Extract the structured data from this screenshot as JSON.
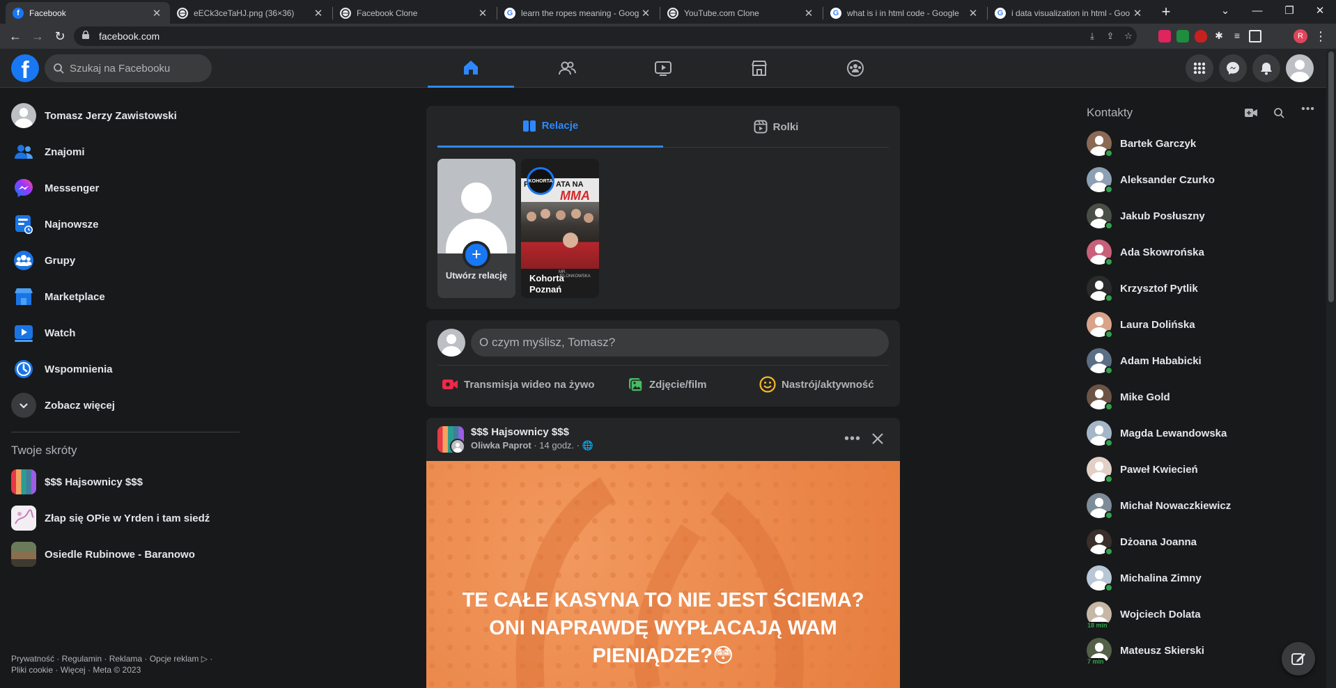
{
  "browser": {
    "tabs": [
      {
        "title": "Facebook",
        "active": true
      },
      {
        "title": "eECk3ceTaHJ.png (36×36)",
        "active": false
      },
      {
        "title": "Facebook Clone",
        "active": false
      },
      {
        "title": "learn the ropes meaning - Goog",
        "active": false
      },
      {
        "title": "YouTube.com Clone",
        "active": false
      },
      {
        "title": "what is i in html code - Google",
        "active": false
      },
      {
        "title": "i data visualization in html - Goo",
        "active": false
      }
    ],
    "address": "facebook.com",
    "profile_initial": "R"
  },
  "fb": {
    "logo": "f",
    "search_placeholder": "Szukaj na Facebooku",
    "user_name": "Tomasz Jerzy Zawistowski"
  },
  "left_menu": [
    {
      "label": "Znajomi",
      "icon": "friends-icon"
    },
    {
      "label": "Messenger",
      "icon": "messenger-icon"
    },
    {
      "label": "Najnowsze",
      "icon": "feeds-icon"
    },
    {
      "label": "Grupy",
      "icon": "groups-icon"
    },
    {
      "label": "Marketplace",
      "icon": "marketplace-icon"
    },
    {
      "label": "Watch",
      "icon": "watch-icon"
    },
    {
      "label": "Wspomnienia",
      "icon": "memories-icon"
    },
    {
      "label": "Zobacz więcej",
      "icon": "chevron-down-icon"
    }
  ],
  "shortcuts": {
    "heading": "Twoje skróty",
    "items": [
      {
        "label": "$$$ Hajsownicy $$$"
      },
      {
        "label": "Złap się OPie w Yrden i tam siedź"
      },
      {
        "label": "Osiedle Rubinowe - Baranowo"
      }
    ]
  },
  "footer": {
    "line1": "Prywatność · Regulamin · Reklama · Opcje reklam ▷ ·",
    "line2": "Pliki cookie · Więcej · Meta © 2023"
  },
  "stories": {
    "tab_active": "Relacje",
    "tab_other": "Rolki",
    "create_label": "Utwórz relację",
    "story_name": "Kohorta Poznań",
    "story_banner_left": "PE",
    "story_banner_right": "ATA NA",
    "story_mma": "MMA",
    "story_badge": "KOHORTA",
    "story_caption": "MR. JELONKOWSKA"
  },
  "composer": {
    "placeholder": "O czym myślisz, Tomasz?",
    "actions": [
      {
        "label": "Transmisja wideo na żywo",
        "color": "#f02849"
      },
      {
        "label": "Zdjęcie/film",
        "color": "#45bd62"
      },
      {
        "label": "Nastrój/aktywność",
        "color": "#f7b928"
      }
    ]
  },
  "post": {
    "group": "$$$ Hajsownicy $$$",
    "author": "Oliwka Paprot",
    "time": "14 godz.",
    "text_line1": "TE CAŁE KASYNA TO NIE JEST ŚCIEMA?",
    "text_line2": "ONI NAPRAWDĘ WYPŁACAJĄ WAM",
    "text_line3": "PIENIĄDZE?😳"
  },
  "contacts": {
    "heading": "Kontakty",
    "items": [
      {
        "name": "Bartek Garczyk",
        "tone": "#8a6a55",
        "mins": ""
      },
      {
        "name": "Aleksander Czurko",
        "tone": "#8da0b3",
        "mins": ""
      },
      {
        "name": "Jakub Posłuszny",
        "tone": "#4a4f46",
        "mins": ""
      },
      {
        "name": "Ada Skowrońska",
        "tone": "#c9607a",
        "mins": ""
      },
      {
        "name": "Krzysztof Pytlik",
        "tone": "#2b2b2b",
        "mins": ""
      },
      {
        "name": "Laura Dolińska",
        "tone": "#d9a38a",
        "mins": ""
      },
      {
        "name": "Adam Hababicki",
        "tone": "#5a6e86",
        "mins": ""
      },
      {
        "name": "Mike Gold",
        "tone": "#6b5446",
        "mins": ""
      },
      {
        "name": "Magda Lewandowska",
        "tone": "#a4b6c8",
        "mins": ""
      },
      {
        "name": "Paweł Kwiecień",
        "tone": "#e2d0c6",
        "mins": ""
      },
      {
        "name": "Michał Nowaczkiewicz",
        "tone": "#7d8c98",
        "mins": ""
      },
      {
        "name": "Dżoana Joanna",
        "tone": "#3a2f2a",
        "mins": ""
      },
      {
        "name": "Michalina Zimny",
        "tone": "#b8c7d6",
        "mins": ""
      },
      {
        "name": "Wojciech Dolata",
        "tone": "#c7b7a6",
        "mins": "18 min"
      },
      {
        "name": "Mateusz Skierski",
        "tone": "#556048",
        "mins": "7 min"
      }
    ]
  }
}
